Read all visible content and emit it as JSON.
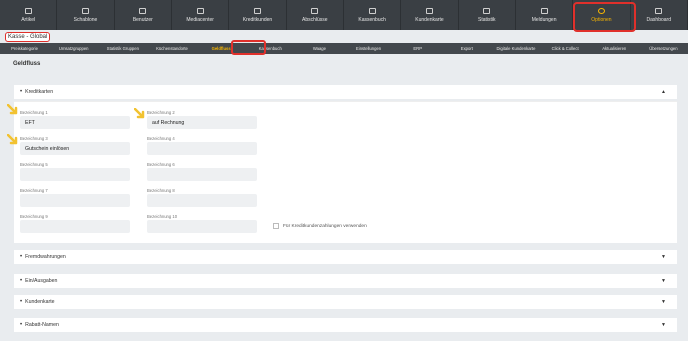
{
  "topnav": {
    "items": [
      {
        "label": "Artikel",
        "icon": "hanger-icon"
      },
      {
        "label": "Schablone",
        "icon": "document-icon"
      },
      {
        "label": "Benutzer",
        "icon": "users-icon"
      },
      {
        "label": "Mediacenter",
        "icon": "monitor-icon"
      },
      {
        "label": "Kreditkunden",
        "icon": "card-icon"
      },
      {
        "label": "Abschlüsse",
        "icon": "receipt-icon"
      },
      {
        "label": "Kassenbuch",
        "icon": "book-icon"
      },
      {
        "label": "Kundenkarte",
        "icon": "customer-card-icon"
      },
      {
        "label": "Statistik",
        "icon": "chart-icon"
      },
      {
        "label": "Meldungen",
        "icon": "mail-icon"
      },
      {
        "label": "Optionen",
        "icon": "gear-icon"
      },
      {
        "label": "Dashboard",
        "icon": "dashboard-icon"
      }
    ],
    "active_index": 10,
    "active_color": "#f7b500"
  },
  "breadcrumb": "Kasse - Global",
  "subnav": {
    "items": [
      "Preiskategorie",
      "Umsatzgruppen",
      "Statistik Gruppen",
      "Küchenstandorte",
      "Geldfluss",
      "Kassenbuch",
      "Waage",
      "Einstellungen",
      "ERP",
      "Export",
      "Digitale Kundenkarte",
      "Click & Collect",
      "Aktualisieren",
      "Übersetzungen"
    ],
    "active_index": 4
  },
  "page_title": "Geldfluss",
  "sections": {
    "kreditkarten": {
      "title": "Kreditkarten",
      "fields": [
        {
          "label": "Bezeichnung 1",
          "value": "EFT"
        },
        {
          "label": "Bezeichnung 2",
          "value": "auf Rechnung"
        },
        {
          "label": "Bezeichnung 3",
          "value": "Gutschein einlösen"
        },
        {
          "label": "Bezeichnung 4",
          "value": ""
        },
        {
          "label": "Bezeichnung 5",
          "value": ""
        },
        {
          "label": "Bezeichnung 6",
          "value": ""
        },
        {
          "label": "Bezeichnung 7",
          "value": ""
        },
        {
          "label": "Bezeichnung 8",
          "value": ""
        },
        {
          "label": "Bezeichnung 9",
          "value": ""
        },
        {
          "label": "Bezeichnung 10",
          "value": ""
        }
      ],
      "checkbox_label": "Für Kreditkundenzahlungen verwenden",
      "checkbox_checked": false
    },
    "collapsed": [
      "Fremdwahrungen",
      "Ein/Ausgaben",
      "Kundenkarte",
      "Rabatt-Namen"
    ]
  },
  "colors": {
    "highlight": "#e0302b",
    "arrow": "#f2c230"
  }
}
